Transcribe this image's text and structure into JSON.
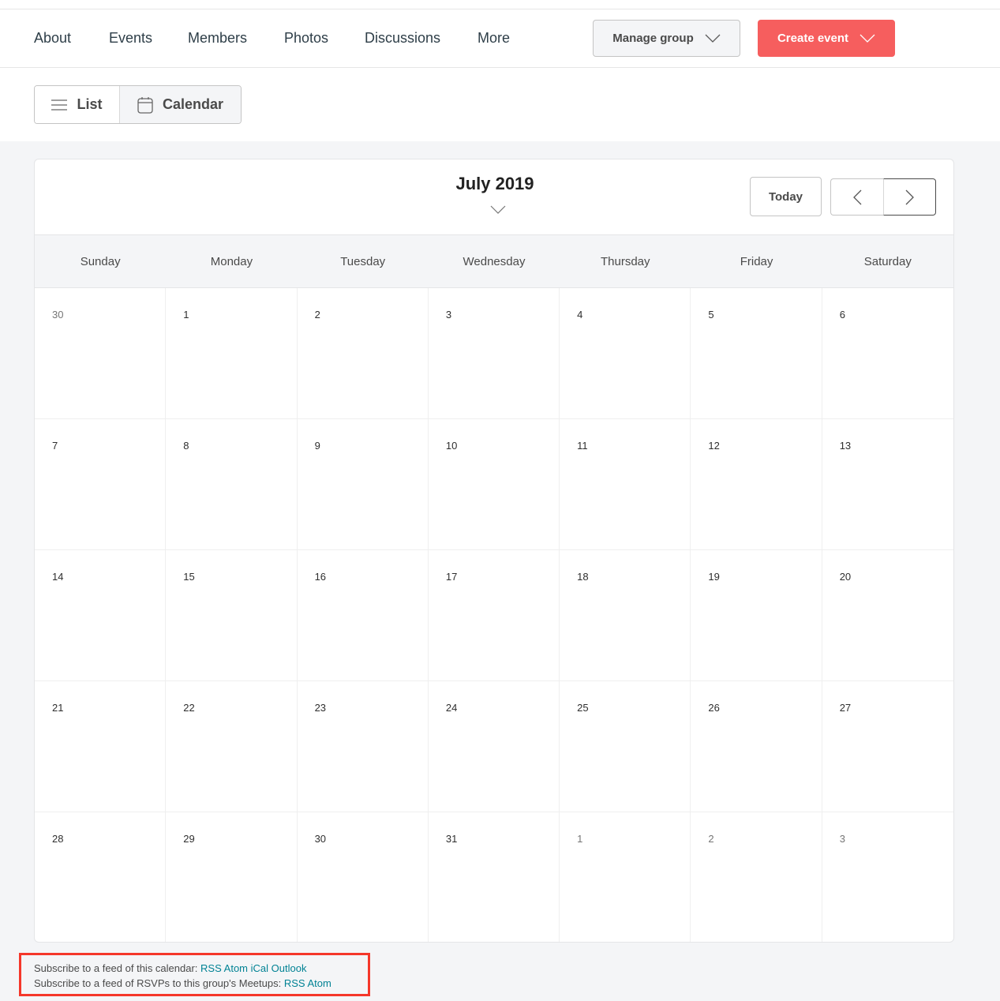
{
  "nav": {
    "links": [
      "About",
      "Events",
      "Members",
      "Photos",
      "Discussions",
      "More"
    ],
    "manage_group": "Manage group",
    "create_event": "Create event"
  },
  "view_toggle": {
    "list": "List",
    "calendar": "Calendar",
    "active": "Calendar"
  },
  "calendar": {
    "month_title": "July 2019",
    "today": "Today",
    "weekdays": [
      "Sunday",
      "Monday",
      "Tuesday",
      "Wednesday",
      "Thursday",
      "Friday",
      "Saturday"
    ],
    "weeks": [
      [
        {
          "d": "30",
          "other": true
        },
        {
          "d": "1"
        },
        {
          "d": "2"
        },
        {
          "d": "3"
        },
        {
          "d": "4"
        },
        {
          "d": "5"
        },
        {
          "d": "6"
        }
      ],
      [
        {
          "d": "7"
        },
        {
          "d": "8"
        },
        {
          "d": "9"
        },
        {
          "d": "10"
        },
        {
          "d": "11"
        },
        {
          "d": "12"
        },
        {
          "d": "13"
        }
      ],
      [
        {
          "d": "14"
        },
        {
          "d": "15"
        },
        {
          "d": "16"
        },
        {
          "d": "17"
        },
        {
          "d": "18"
        },
        {
          "d": "19"
        },
        {
          "d": "20"
        }
      ],
      [
        {
          "d": "21"
        },
        {
          "d": "22"
        },
        {
          "d": "23"
        },
        {
          "d": "24"
        },
        {
          "d": "25"
        },
        {
          "d": "26"
        },
        {
          "d": "27"
        }
      ],
      [
        {
          "d": "28"
        },
        {
          "d": "29"
        },
        {
          "d": "30"
        },
        {
          "d": "31"
        },
        {
          "d": "1",
          "other": true
        },
        {
          "d": "2",
          "other": true
        },
        {
          "d": "3",
          "other": true
        }
      ]
    ]
  },
  "feeds": {
    "calendar_label": "Subscribe to a feed of this calendar:",
    "calendar_links": [
      "RSS",
      "Atom",
      "iCal",
      "Outlook"
    ],
    "rsvp_label": "Subscribe to a feed of RSVPs to this group's Meetups:",
    "rsvp_links": [
      "RSS",
      "Atom"
    ]
  },
  "colors": {
    "brand_red": "#f65e5e",
    "link_teal": "#008294",
    "highlight_box": "#f5372a"
  }
}
